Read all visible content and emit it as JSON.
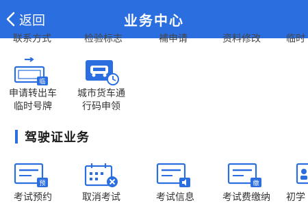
{
  "header": {
    "back_label": "返回",
    "title": "业务中心"
  },
  "cut_row": {
    "items": [
      "联系方式",
      "检验标志",
      "補申请",
      "资料修改",
      "临时"
    ]
  },
  "vehicle_services": [
    {
      "label_line1": "申请转出车",
      "label_line2": "临时号牌",
      "icon": "license-plate-transfer-icon",
      "badge": "临"
    },
    {
      "label_line1": "城市货车通",
      "label_line2": "行码申领",
      "icon": "truck-pass-code-icon"
    }
  ],
  "license_section": {
    "title": "驾驶证业务",
    "items": [
      {
        "label": "考试预约",
        "icon": "exam-booking-icon",
        "badge": "预"
      },
      {
        "label": "取消考试",
        "icon": "cancel-exam-calendar-icon"
      },
      {
        "label": "考试信息",
        "icon": "exam-info-icon"
      },
      {
        "label": "考试费缴纳",
        "icon": "exam-fee-payment-icon",
        "badge": "缴"
      },
      {
        "label": "初学",
        "icon": "learner-icon"
      }
    ]
  },
  "colors": {
    "accent": "#2a6ee0",
    "text": "#333333"
  }
}
